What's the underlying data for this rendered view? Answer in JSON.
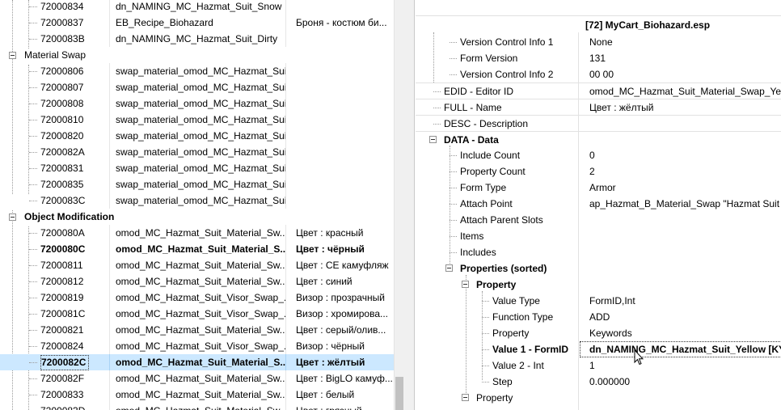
{
  "left_tree": {
    "rows": [
      {
        "id": "72000834",
        "name": "dn_NAMING_MC_Hazmat_Suit_Snow",
        "desc": ""
      },
      {
        "id": "72000837",
        "name": "EB_Recipe_Biohazard",
        "desc": "Броня - костюм би..."
      },
      {
        "id": "7200083B",
        "name": "dn_NAMING_MC_Hazmat_Suit_Dirty",
        "desc": ""
      },
      {
        "group": "Material Swap"
      },
      {
        "id": "72000806",
        "name": "swap_material_omod_MC_Hazmat_Suit_Default",
        "desc": ""
      },
      {
        "id": "72000807",
        "name": "swap_material_omod_MC_Hazmat_Suit_Black",
        "desc": ""
      },
      {
        "id": "72000808",
        "name": "swap_material_omod_MC_Hazmat_Suit_CCE",
        "desc": ""
      },
      {
        "id": "72000810",
        "name": "swap_material_omod_MC_Hazmat_Suit_Blue",
        "desc": ""
      },
      {
        "id": "72000820",
        "name": "swap_material_omod_MC_Hazmat_Suit_Grey",
        "desc": ""
      },
      {
        "id": "7200082A",
        "name": "swap_material_omod_MC_Hazmat_Suit_Yellow",
        "desc": ""
      },
      {
        "id": "72000831",
        "name": "swap_material_omod_MC_Hazmat_Suit_BigLO",
        "desc": ""
      },
      {
        "id": "72000835",
        "name": "swap_material_omod_MC_Hazmat_Suit_Snow",
        "desc": ""
      },
      {
        "id": "7200083C",
        "name": "swap_material_omod_MC_Hazmat_Suit_Dirty",
        "desc": ""
      },
      {
        "group": "Object Modification"
      },
      {
        "id": "7200080A",
        "name": "omod_MC_Hazmat_Suit_Material_Sw...",
        "desc": "Цвет : красный"
      },
      {
        "id": "7200080C",
        "name": "omod_MC_Hazmat_Suit_Material_S...",
        "desc": "Цвет : чёрный"
      },
      {
        "id": "72000811",
        "name": "omod_MC_Hazmat_Suit_Material_Sw...",
        "desc": "Цвет : CE камуфляж"
      },
      {
        "id": "72000812",
        "name": "omod_MC_Hazmat_Suit_Material_Sw...",
        "desc": "Цвет : синий"
      },
      {
        "id": "72000819",
        "name": "omod_MC_Hazmat_Suit_Visor_Swap_...",
        "desc": "Визор : прозрачный"
      },
      {
        "id": "7200081C",
        "name": "omod_MC_Hazmat_Suit_Visor_Swap_...",
        "desc": "Визор : хромирова..."
      },
      {
        "id": "72000821",
        "name": "omod_MC_Hazmat_Suit_Material_Sw...",
        "desc": "Цвет : серый/олив..."
      },
      {
        "id": "72000824",
        "name": "omod_MC_Hazmat_Suit_Visor_Swap_...",
        "desc": "Визор : чёрный"
      },
      {
        "id": "7200082C",
        "name": "omod_MC_Hazmat_Suit_Material_S...",
        "desc": "Цвет : жёлтый"
      },
      {
        "id": "7200082F",
        "name": "omod_MC_Hazmat_Suit_Material_Sw...",
        "desc": "Цвет : BigLO камуф..."
      },
      {
        "id": "72000833",
        "name": "omod_MC_Hazmat_Suit_Material_Sw...",
        "desc": "Цвет : белый"
      },
      {
        "id": "7200083D",
        "name": "omod_MC_Hazmat_Suit_Material_Sw...",
        "desc": "Цвет : грязный"
      }
    ]
  },
  "record_view": {
    "file_header": "[72] MyCart_Biohazard.esp",
    "rows": [
      {
        "label": "Version Control Info 1",
        "value": "None"
      },
      {
        "label": "Form Version",
        "value": "131"
      },
      {
        "label": "Version Control Info 2",
        "value": "00 00"
      },
      {
        "label": "EDID - Editor ID",
        "value": "omod_MC_Hazmat_Suit_Material_Swap_Yellow"
      },
      {
        "label": "FULL - Name",
        "value": "Цвет : жёлтый"
      },
      {
        "label": "DESC - Description",
        "value": ""
      },
      {
        "label": "DATA - Data",
        "value": ""
      },
      {
        "label": "Include Count",
        "value": "0"
      },
      {
        "label": "Property Count",
        "value": "2"
      },
      {
        "label": "Form Type",
        "value": "Armor"
      },
      {
        "label": "Attach Point",
        "value": "ap_Hazmat_B_Material_Swap \"Hazmat Suit Le"
      },
      {
        "label": "Attach Parent Slots",
        "value": ""
      },
      {
        "label": "Items",
        "value": ""
      },
      {
        "label": "Includes",
        "value": ""
      },
      {
        "label": "Properties (sorted)",
        "value": ""
      },
      {
        "label": "Property",
        "value": ""
      },
      {
        "label": "Value Type",
        "value": "FormID,Int"
      },
      {
        "label": "Function Type",
        "value": "ADD"
      },
      {
        "label": "Property",
        "value": "Keywords"
      },
      {
        "label": "Value 1 - FormID",
        "value": "dn_NAMING_MC_Hazmat_Suit_Yellow [KY..."
      },
      {
        "label": "Value 2 - Int",
        "value": "1"
      },
      {
        "label": "Step",
        "value": "0.000000"
      },
      {
        "label": "Property",
        "value": ""
      }
    ]
  },
  "colors": {
    "selection": "#cce8ff",
    "grid": "#e2e2e2",
    "scrollbar": "#f0f0f0"
  },
  "icons": [
    "collapse-icon",
    "mouse-cursor-icon"
  ]
}
